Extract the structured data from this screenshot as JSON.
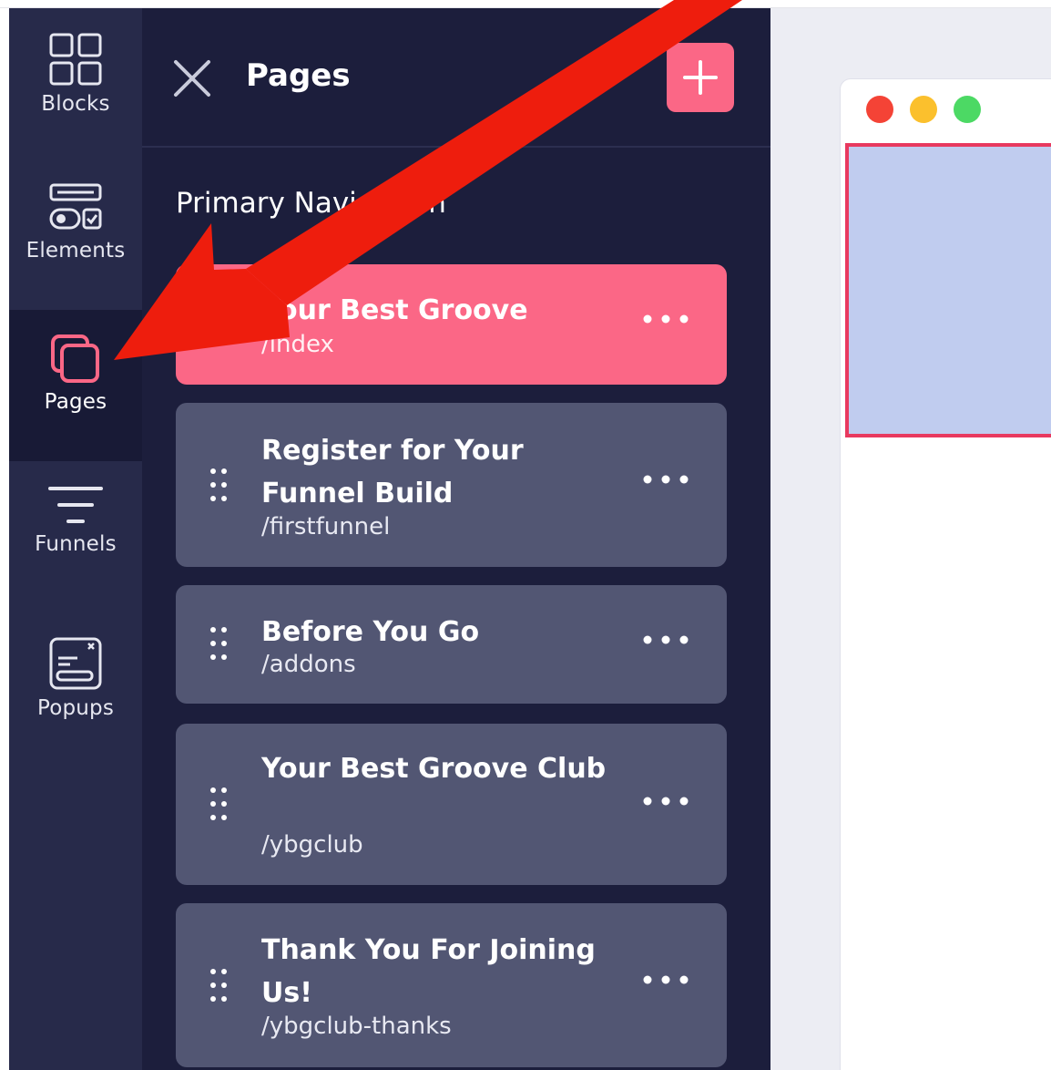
{
  "rail": {
    "items": [
      {
        "label": "Blocks",
        "icon": "blocks-icon"
      },
      {
        "label": "Elements",
        "icon": "elements-icon"
      },
      {
        "label": "Pages",
        "icon": "pages-icon",
        "active": true
      },
      {
        "label": "Funnels",
        "icon": "funnels-icon"
      },
      {
        "label": "Popups",
        "icon": "popups-icon"
      }
    ]
  },
  "panel": {
    "title": "Pages",
    "section_title": "Primary Navigation",
    "pages": [
      {
        "title": "Your Best Groove",
        "slug": "/index",
        "active": true
      },
      {
        "title": "Register for Your Funnel Build",
        "slug": "/firstfunnel"
      },
      {
        "title": "Before You Go",
        "slug": "/addons"
      },
      {
        "title": "Your Best Groove Club",
        "slug": "/ybgclub"
      },
      {
        "title": "Thank You For Joining Us!",
        "slug": "/ybgclub-thanks"
      }
    ]
  },
  "colors": {
    "rail_bg": "#272a4a",
    "rail_active_bg": "#181a36",
    "panel_bg": "#1c1e3c",
    "card_bg": "#525673",
    "accent_pink": "#fb6786",
    "arrow_red": "#ee1d0d",
    "window_red": "#f44336",
    "window_yellow": "#fbc02d",
    "window_green": "#4cd964",
    "selection_fill": "#c0ccef",
    "selection_border": "#e8395f"
  }
}
